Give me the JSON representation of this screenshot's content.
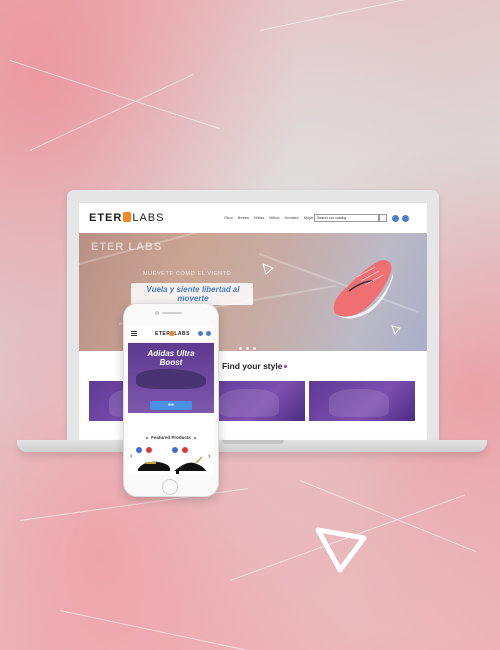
{
  "desktop": {
    "logo": {
      "left": "ETER",
      "right": "LABS"
    },
    "nav": [
      "Otoo",
      "Bebés",
      "Niñas",
      "Niños",
      "Hombre",
      "Mujer"
    ],
    "search_placeholder": "Search our catalog",
    "hero": {
      "watermark_logo": "ETER LABS",
      "tagline": "MUÉVETE COMO EL VIENTO",
      "cta": "Vuela y siente libertad al moverte"
    },
    "section_title": "Find your style"
  },
  "mobile": {
    "logo": {
      "left": "ETER",
      "right": "LABS"
    },
    "hero_title": "Adidas Ultra Boost",
    "featured_title": "Featured Products",
    "nav_prev": "‹",
    "nav_next": "›"
  },
  "colors": {
    "accent_blue": "#4a7fd0",
    "logo_orange": "#f08a24",
    "purple": "#5e3b95",
    "pink_background": "#eeb3b7"
  },
  "icons": [
    "search-icon",
    "user-icon",
    "cart-icon",
    "hamburger-menu-icon",
    "triangle-icon"
  ]
}
